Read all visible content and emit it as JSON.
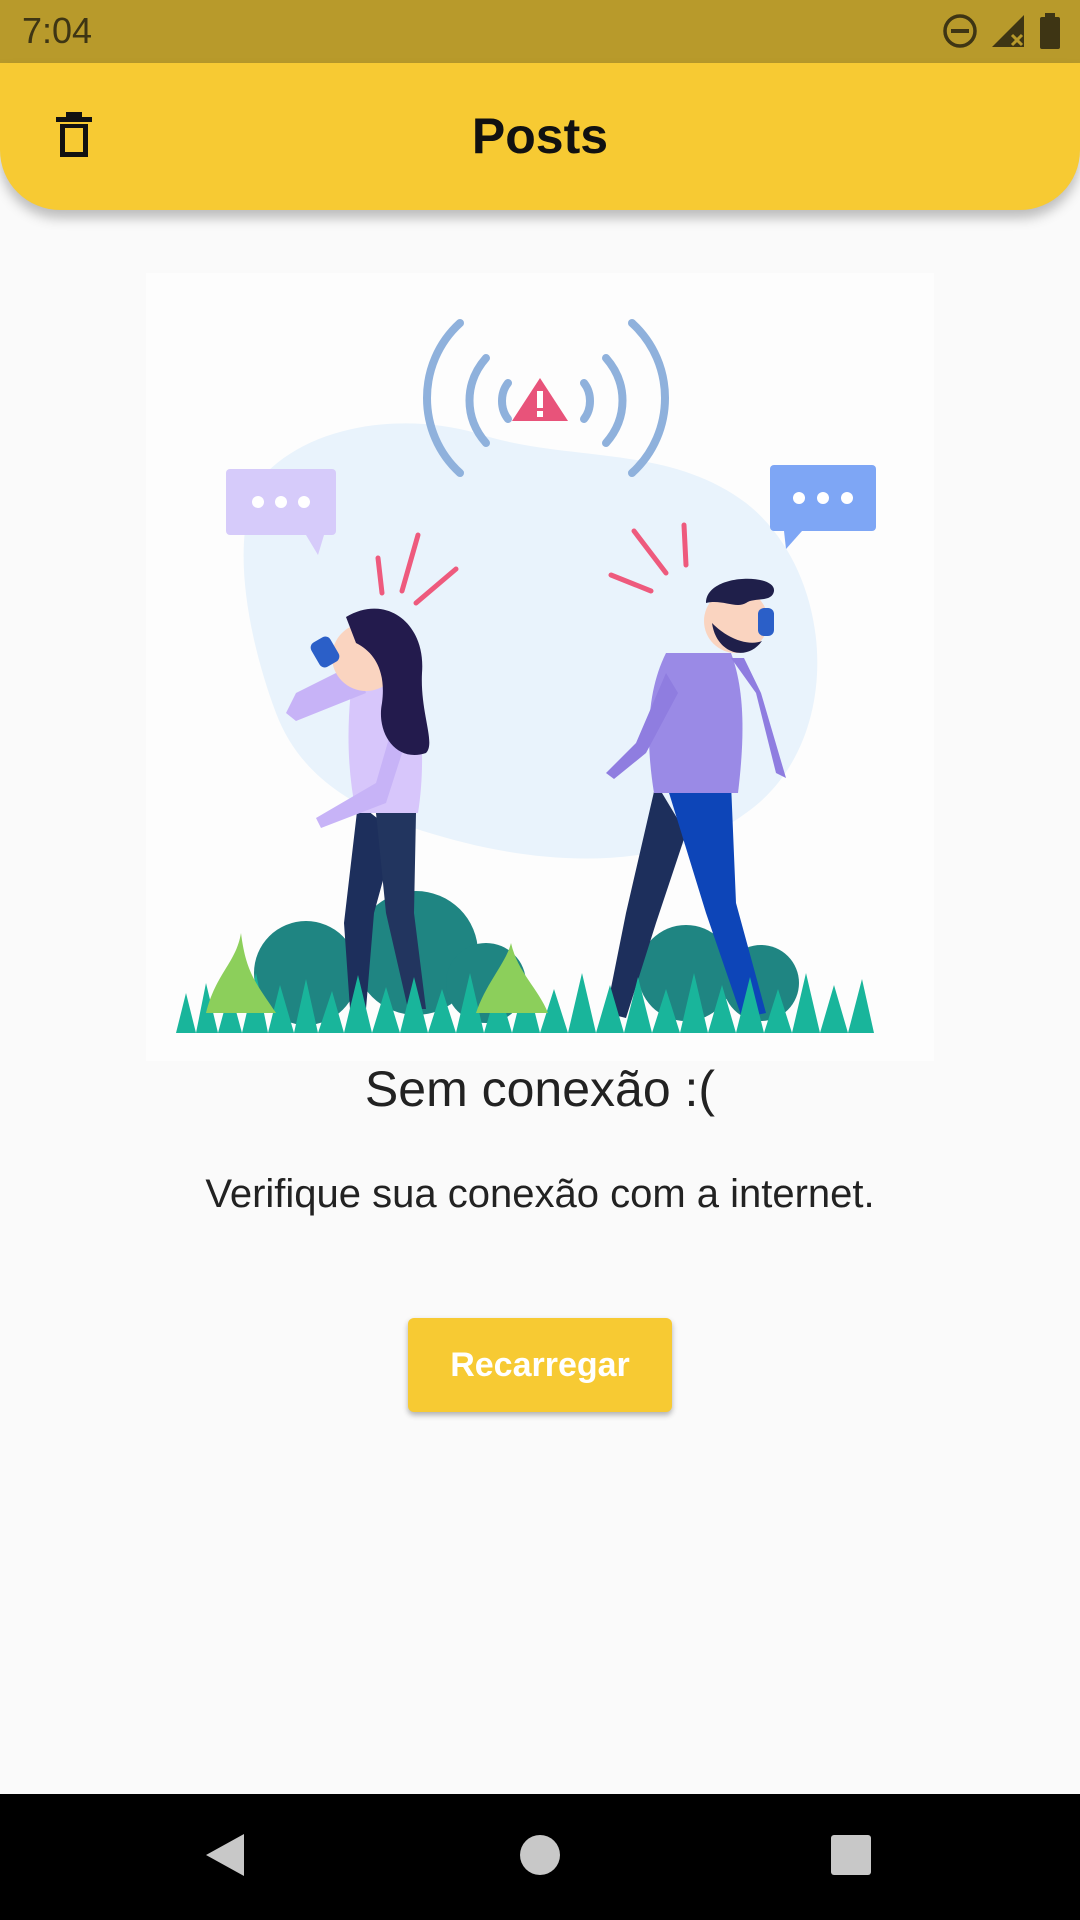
{
  "status_bar": {
    "time": "7:04",
    "icons": [
      "do-not-disturb-icon",
      "signal-off-icon",
      "battery-icon"
    ]
  },
  "app_bar": {
    "title": "Posts",
    "left_icon": "trash-icon",
    "color": "#f7ca33"
  },
  "empty_state": {
    "illustration": "no-connection-illustration",
    "title": "Sem conexão :(",
    "message": "Verifique sua conexão com a internet.",
    "button_label": "Recarregar"
  },
  "nav_bar": {
    "icons": [
      "back-icon",
      "home-icon",
      "recents-icon"
    ]
  },
  "colors": {
    "accent": "#f7ca33",
    "status_bar": "#b89a2b",
    "background": "#fafafa"
  }
}
